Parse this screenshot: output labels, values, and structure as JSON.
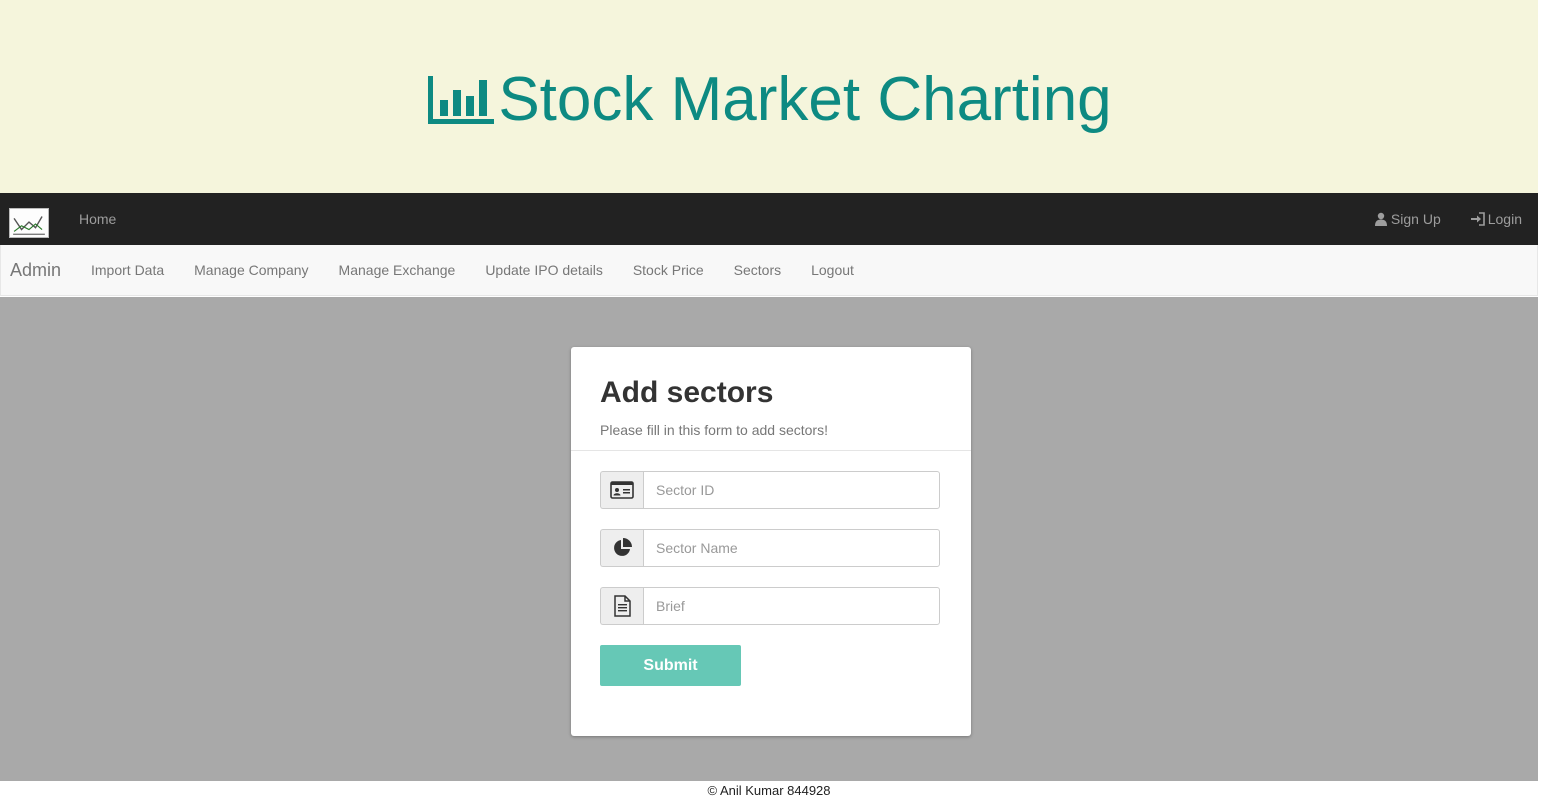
{
  "banner": {
    "title": "Stock Market Charting",
    "icon": "bar-chart-icon",
    "color": "#0d8a82",
    "background": "#f5f5dc"
  },
  "navbar": {
    "logo": "stock-chart-logo",
    "home_label": "Home",
    "signup_label": "Sign Up",
    "signup_icon": "user-icon",
    "login_label": "Login",
    "login_icon": "log-in-icon"
  },
  "subnav": {
    "brand": "Admin",
    "links": [
      "Import Data",
      "Manage Company",
      "Manage Exchange",
      "Update IPO details",
      "Stock Price",
      "Sectors",
      "Logout"
    ]
  },
  "form": {
    "title": "Add sectors",
    "subtitle": "Please fill in this form to add sectors!",
    "fields": [
      {
        "icon": "id-card-icon",
        "placeholder": "Sector ID",
        "value": ""
      },
      {
        "icon": "pie-chart-icon",
        "placeholder": "Sector Name",
        "value": ""
      },
      {
        "icon": "document-icon",
        "placeholder": "Brief",
        "value": ""
      }
    ],
    "submit_label": "Submit",
    "submit_color": "#66c8b6"
  },
  "footer": {
    "text": "© Anil Kumar 844928"
  }
}
